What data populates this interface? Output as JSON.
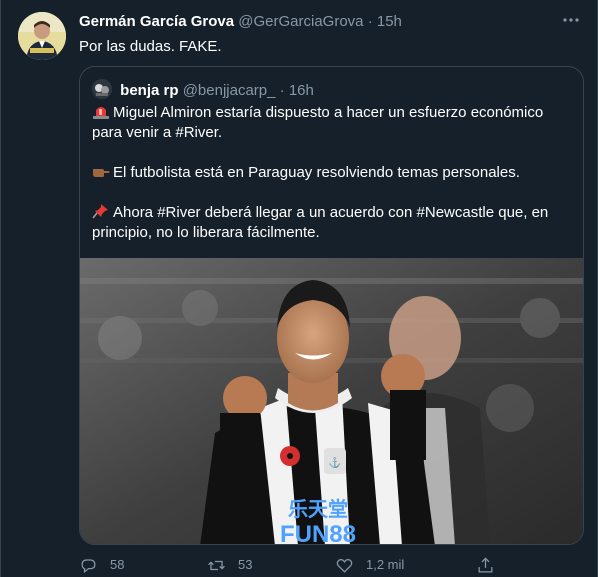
{
  "tweet": {
    "author_name": "Germán García Grova",
    "author_handle": "@GerGarciaGrova",
    "separator": "·",
    "time": "15h",
    "text": "Por las dudas. FAKE."
  },
  "quoted_tweet": {
    "author_name": "benja rp",
    "author_handle": "@benjjacarp_",
    "separator": "·",
    "time": "16h",
    "paragraphs": [
      {
        "emoji": "rotating-light-icon",
        "text": "Miguel Almiron estaría dispuesto a hacer un esfuerzo económico para venir a #River."
      },
      {
        "emoji": "pointing-hand-icon",
        "text": "El futbolista está en Paraguay resolviendo temas personales."
      },
      {
        "emoji": "pushpin-icon",
        "text": "Ahora #River deberá llegar a un acuerdo con #Newcastle que, en principio, no lo liberara fácilmente."
      }
    ],
    "image": {
      "shirt_text_top": "乐天堂",
      "shirt_text_bottom": "FUN88"
    }
  },
  "actions": {
    "replies": "58",
    "retweets": "53",
    "likes": "1,2 mil",
    "share": ""
  },
  "colors": {
    "background": "#15202b",
    "border": "#38444d",
    "secondary_text": "#8899a6"
  }
}
